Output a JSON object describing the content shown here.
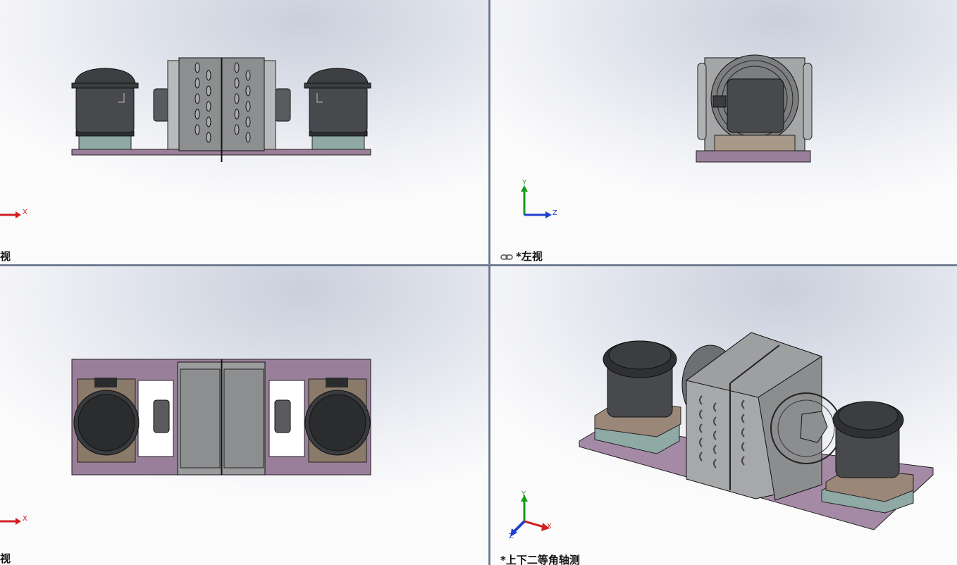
{
  "viewports": {
    "front": {
      "label": "视"
    },
    "left": {
      "label": "*左视"
    },
    "top": {
      "label": "视"
    },
    "iso": {
      "label": "*上下二等角轴测"
    }
  },
  "triads": {
    "front": [
      "X"
    ],
    "left": [
      "Y",
      "Z"
    ],
    "top": [
      "X"
    ],
    "iso": [
      "Y",
      "X",
      "Z"
    ]
  },
  "icons": [
    "link-icon",
    "coordinate-triad-icon"
  ],
  "colors": {
    "background_top": "#c9cfdc",
    "background_bottom": "#fbfbfc",
    "base_plate": "#9a7f9a",
    "compressor": "#4a4b4e",
    "condenser": "#8d8e90",
    "pad": "#8fa9a5",
    "axis_x": "#d02020",
    "axis_y": "#1a9a1a",
    "axis_z": "#2040d0"
  }
}
